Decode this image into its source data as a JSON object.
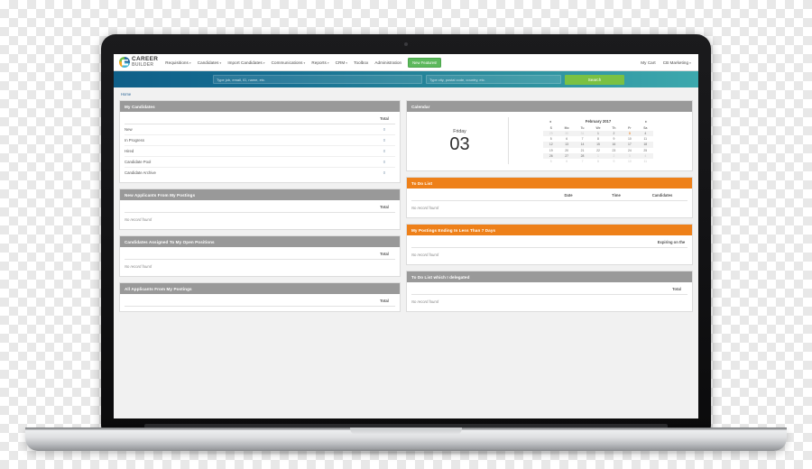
{
  "brand": {
    "logo_line1": "CAREER",
    "logo_line2": "BUILDER",
    "accent_green": "#7ac143",
    "accent_orange": "#ee8019",
    "accent_gray": "#999999",
    "accent_blue": "#0f5f88",
    "accent_teal": "#3ca8ad"
  },
  "topnav": {
    "items": [
      {
        "label": "Requisitions",
        "caret": "▾"
      },
      {
        "label": "Candidates",
        "caret": "▾"
      },
      {
        "label": "Import Candidates",
        "caret": "▾"
      },
      {
        "label": "Communications",
        "caret": "▾"
      },
      {
        "label": "Reports",
        "caret": "▾"
      },
      {
        "label": "CRM",
        "caret": "▾"
      },
      {
        "label": "Toolbox",
        "caret": ""
      },
      {
        "label": "Administration",
        "caret": ""
      }
    ],
    "feature_button": "New Features!",
    "right": [
      {
        "label": "My Cart",
        "caret": ""
      },
      {
        "label": "CB Marketing",
        "caret": "▾"
      }
    ]
  },
  "search": {
    "keyword_placeholder": "Type job, email, ID, name, etc.",
    "location_placeholder": "Type city, postal code, country, etc.",
    "button_label": "Search"
  },
  "breadcrumb": "Home",
  "panels": {
    "my_candidates": {
      "title": "My Candidates",
      "total_header": "Total",
      "rows": [
        {
          "label": "New",
          "total": "0"
        },
        {
          "label": "In Progress",
          "total": "0"
        },
        {
          "label": "Hired",
          "total": "0"
        },
        {
          "label": "Candidate Pool",
          "total": "0"
        },
        {
          "label": "Candidate Archive",
          "total": "0"
        }
      ]
    },
    "new_applicants": {
      "title": "New Applicants From My Postings",
      "total_header": "Total",
      "empty": "No record found"
    },
    "assigned_candidates": {
      "title": "Candidates Assigned To My Open Positions",
      "total_header": "Total",
      "empty": "No record found"
    },
    "all_applicants": {
      "title": "All Applicants From My Postings",
      "total_header": "Total"
    },
    "calendar": {
      "title": "Calendar",
      "weekday": "Friday",
      "day_number": "03",
      "month_label": "February 2017",
      "prev_arrow": "◄",
      "next_arrow": "►",
      "dow": [
        "S",
        "Mo",
        "Tu",
        "We",
        "Th",
        "Fr",
        "Sa"
      ],
      "weeks": [
        [
          {
            "n": "29",
            "type": "muted"
          },
          {
            "n": "30",
            "type": "muted"
          },
          {
            "n": "31",
            "type": "muted"
          },
          {
            "n": "1",
            "type": "cur"
          },
          {
            "n": "2",
            "type": "cur"
          },
          {
            "n": "3",
            "type": "today"
          },
          {
            "n": "4",
            "type": "cur"
          }
        ],
        [
          {
            "n": "5",
            "type": "cur"
          },
          {
            "n": "6",
            "type": "cur"
          },
          {
            "n": "7",
            "type": "cur"
          },
          {
            "n": "8",
            "type": "cur"
          },
          {
            "n": "9",
            "type": "cur"
          },
          {
            "n": "10",
            "type": "cur"
          },
          {
            "n": "11",
            "type": "cur"
          }
        ],
        [
          {
            "n": "12",
            "type": "cur"
          },
          {
            "n": "13",
            "type": "cur"
          },
          {
            "n": "14",
            "type": "cur"
          },
          {
            "n": "15",
            "type": "cur"
          },
          {
            "n": "16",
            "type": "cur"
          },
          {
            "n": "17",
            "type": "cur"
          },
          {
            "n": "18",
            "type": "cur"
          }
        ],
        [
          {
            "n": "19",
            "type": "cur"
          },
          {
            "n": "20",
            "type": "cur"
          },
          {
            "n": "21",
            "type": "cur"
          },
          {
            "n": "22",
            "type": "cur"
          },
          {
            "n": "23",
            "type": "cur"
          },
          {
            "n": "24",
            "type": "cur"
          },
          {
            "n": "25",
            "type": "cur"
          }
        ],
        [
          {
            "n": "26",
            "type": "cur"
          },
          {
            "n": "27",
            "type": "cur"
          },
          {
            "n": "28",
            "type": "cur"
          },
          {
            "n": "1",
            "type": "muted"
          },
          {
            "n": "2",
            "type": "muted"
          },
          {
            "n": "3",
            "type": "muted"
          },
          {
            "n": "4",
            "type": "muted"
          }
        ],
        [
          {
            "n": "5",
            "type": "muted"
          },
          {
            "n": "6",
            "type": "muted"
          },
          {
            "n": "7",
            "type": "muted"
          },
          {
            "n": "8",
            "type": "muted"
          },
          {
            "n": "9",
            "type": "muted"
          },
          {
            "n": "10",
            "type": "muted"
          },
          {
            "n": "11",
            "type": "muted"
          }
        ]
      ]
    },
    "todo_list": {
      "title": "To Do List",
      "col_date": "Date",
      "col_time": "Time",
      "col_candidates": "Candidates",
      "empty": "No record found"
    },
    "postings_ending": {
      "title": "My Postings Ending In Less Than 7 Days",
      "col_expiring": "Expiring on the",
      "empty": "No record found"
    },
    "todo_delegated": {
      "title": "To Do List which I delegated",
      "total_header": "Total",
      "empty": "No record found"
    }
  }
}
